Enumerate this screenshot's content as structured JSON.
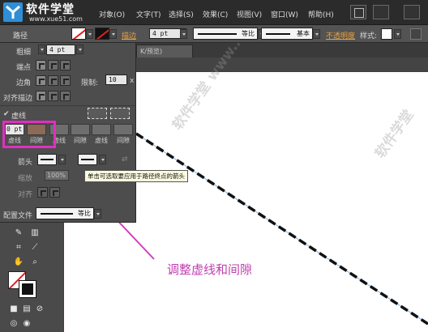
{
  "brand": {
    "title": "软件学堂",
    "url": "www.xue51.com"
  },
  "menu": [
    "对象(O)",
    "文字(T)",
    "选择(S)",
    "效果(C)",
    "视图(V)",
    "窗口(W)",
    "帮助(H)"
  ],
  "control_bar": {
    "path_label": "路径",
    "stroke_label": "描边",
    "stroke_weight": "4 pt",
    "profile_label": "等比",
    "brush_label": "基本",
    "opacity_label": "不透明度",
    "style_label": "样式:"
  },
  "document_tab": "K/预览)",
  "stroke_panel": {
    "weight_label": "粗细",
    "weight_value": "4 pt",
    "cap_label": "端点",
    "corner_label": "边角",
    "limit_label": "限制:",
    "limit_value": "10",
    "limit_unit": "x",
    "align_label": "对齐描边",
    "dashed_label": "虚线",
    "dashed_checked": true,
    "dash_first_value": "0 pt",
    "dash_labels": [
      "虚线",
      "间隙",
      "虚线",
      "间隙",
      "虚线",
      "间隙"
    ],
    "arrow_label": "箭头",
    "scale_label": "缩放",
    "scale_value": "100%",
    "align2_label": "对齐",
    "profile_label": "配置文件",
    "profile_value": "等比"
  },
  "tooltip": "单击可选取要应用于路径终点的箭头",
  "annotation": "调整虚线和间隙",
  "watermark": "软件学堂 www.xue51.com",
  "colors": {
    "highlight": "#e030c0",
    "annotation": "#c040b0",
    "accent_orange": "#e8a040"
  }
}
